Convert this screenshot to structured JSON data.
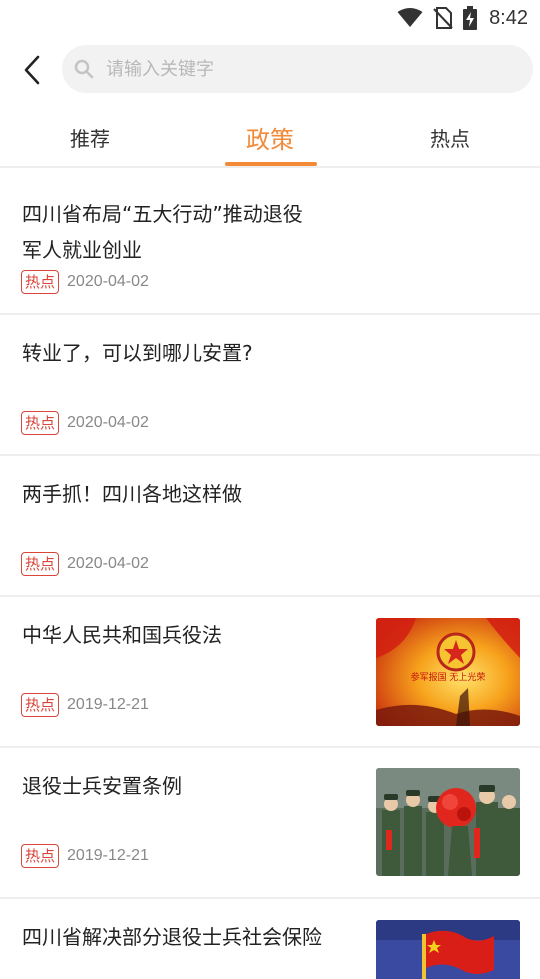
{
  "status_bar": {
    "time": "8:42",
    "icons": [
      "wifi-icon",
      "no-sim-icon",
      "battery-charging-icon"
    ]
  },
  "search": {
    "placeholder": "请输入关键字",
    "value": ""
  },
  "tabs": [
    {
      "label": "推荐",
      "active": false
    },
    {
      "label": "政策",
      "active": true
    },
    {
      "label": "热点",
      "active": false
    }
  ],
  "colors": {
    "accent": "#f28a38",
    "badge": "#d9453a",
    "divider": "#eeeeee"
  },
  "news": [
    {
      "title_line1": "四川省布局“五大行动”推动退役",
      "title_line2": "军人就业创业",
      "badge": "热点",
      "date": "2020-04-02",
      "has_image": false
    },
    {
      "title_line1": "转业了，可以到哪儿安置?",
      "badge": "热点",
      "date": "2020-04-02",
      "has_image": false
    },
    {
      "title_line1": "两手抓！四川各地这样做",
      "badge": "热点",
      "date": "2020-04-02",
      "has_image": false
    },
    {
      "title_line1": "中华人民共和国兵役法",
      "badge": "热点",
      "date": "2019-12-21",
      "has_image": true,
      "image_text": "参军报国 无上光荣"
    },
    {
      "title_line1": "退役士兵安置条例",
      "badge": "热点",
      "date": "2019-12-21",
      "has_image": true
    },
    {
      "title_line1": "四川省解决部分退役士兵社会保险",
      "has_image": true
    }
  ]
}
